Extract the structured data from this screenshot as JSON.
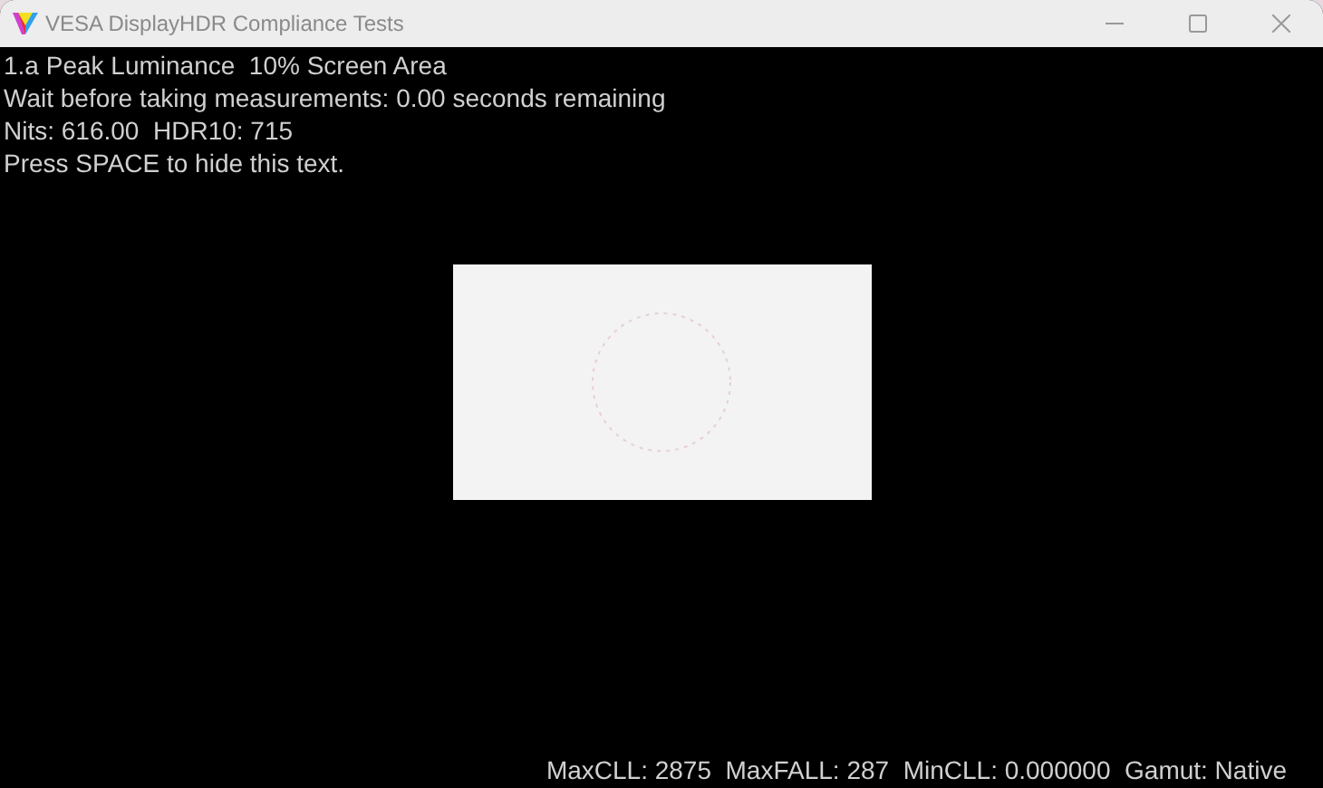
{
  "window": {
    "title": "VESA DisplayHDR Compliance Tests"
  },
  "info_lines": [
    "1.a Peak Luminance  10% Screen Area",
    "Wait before taking measurements: 0.00 seconds remaining",
    "Nits: 616.00  HDR10: 715",
    "Press SPACE to hide this text."
  ],
  "status_line": "MaxCLL: 2875  MaxFALL: 287  MinCLL: 0.000000  Gamut: Native"
}
